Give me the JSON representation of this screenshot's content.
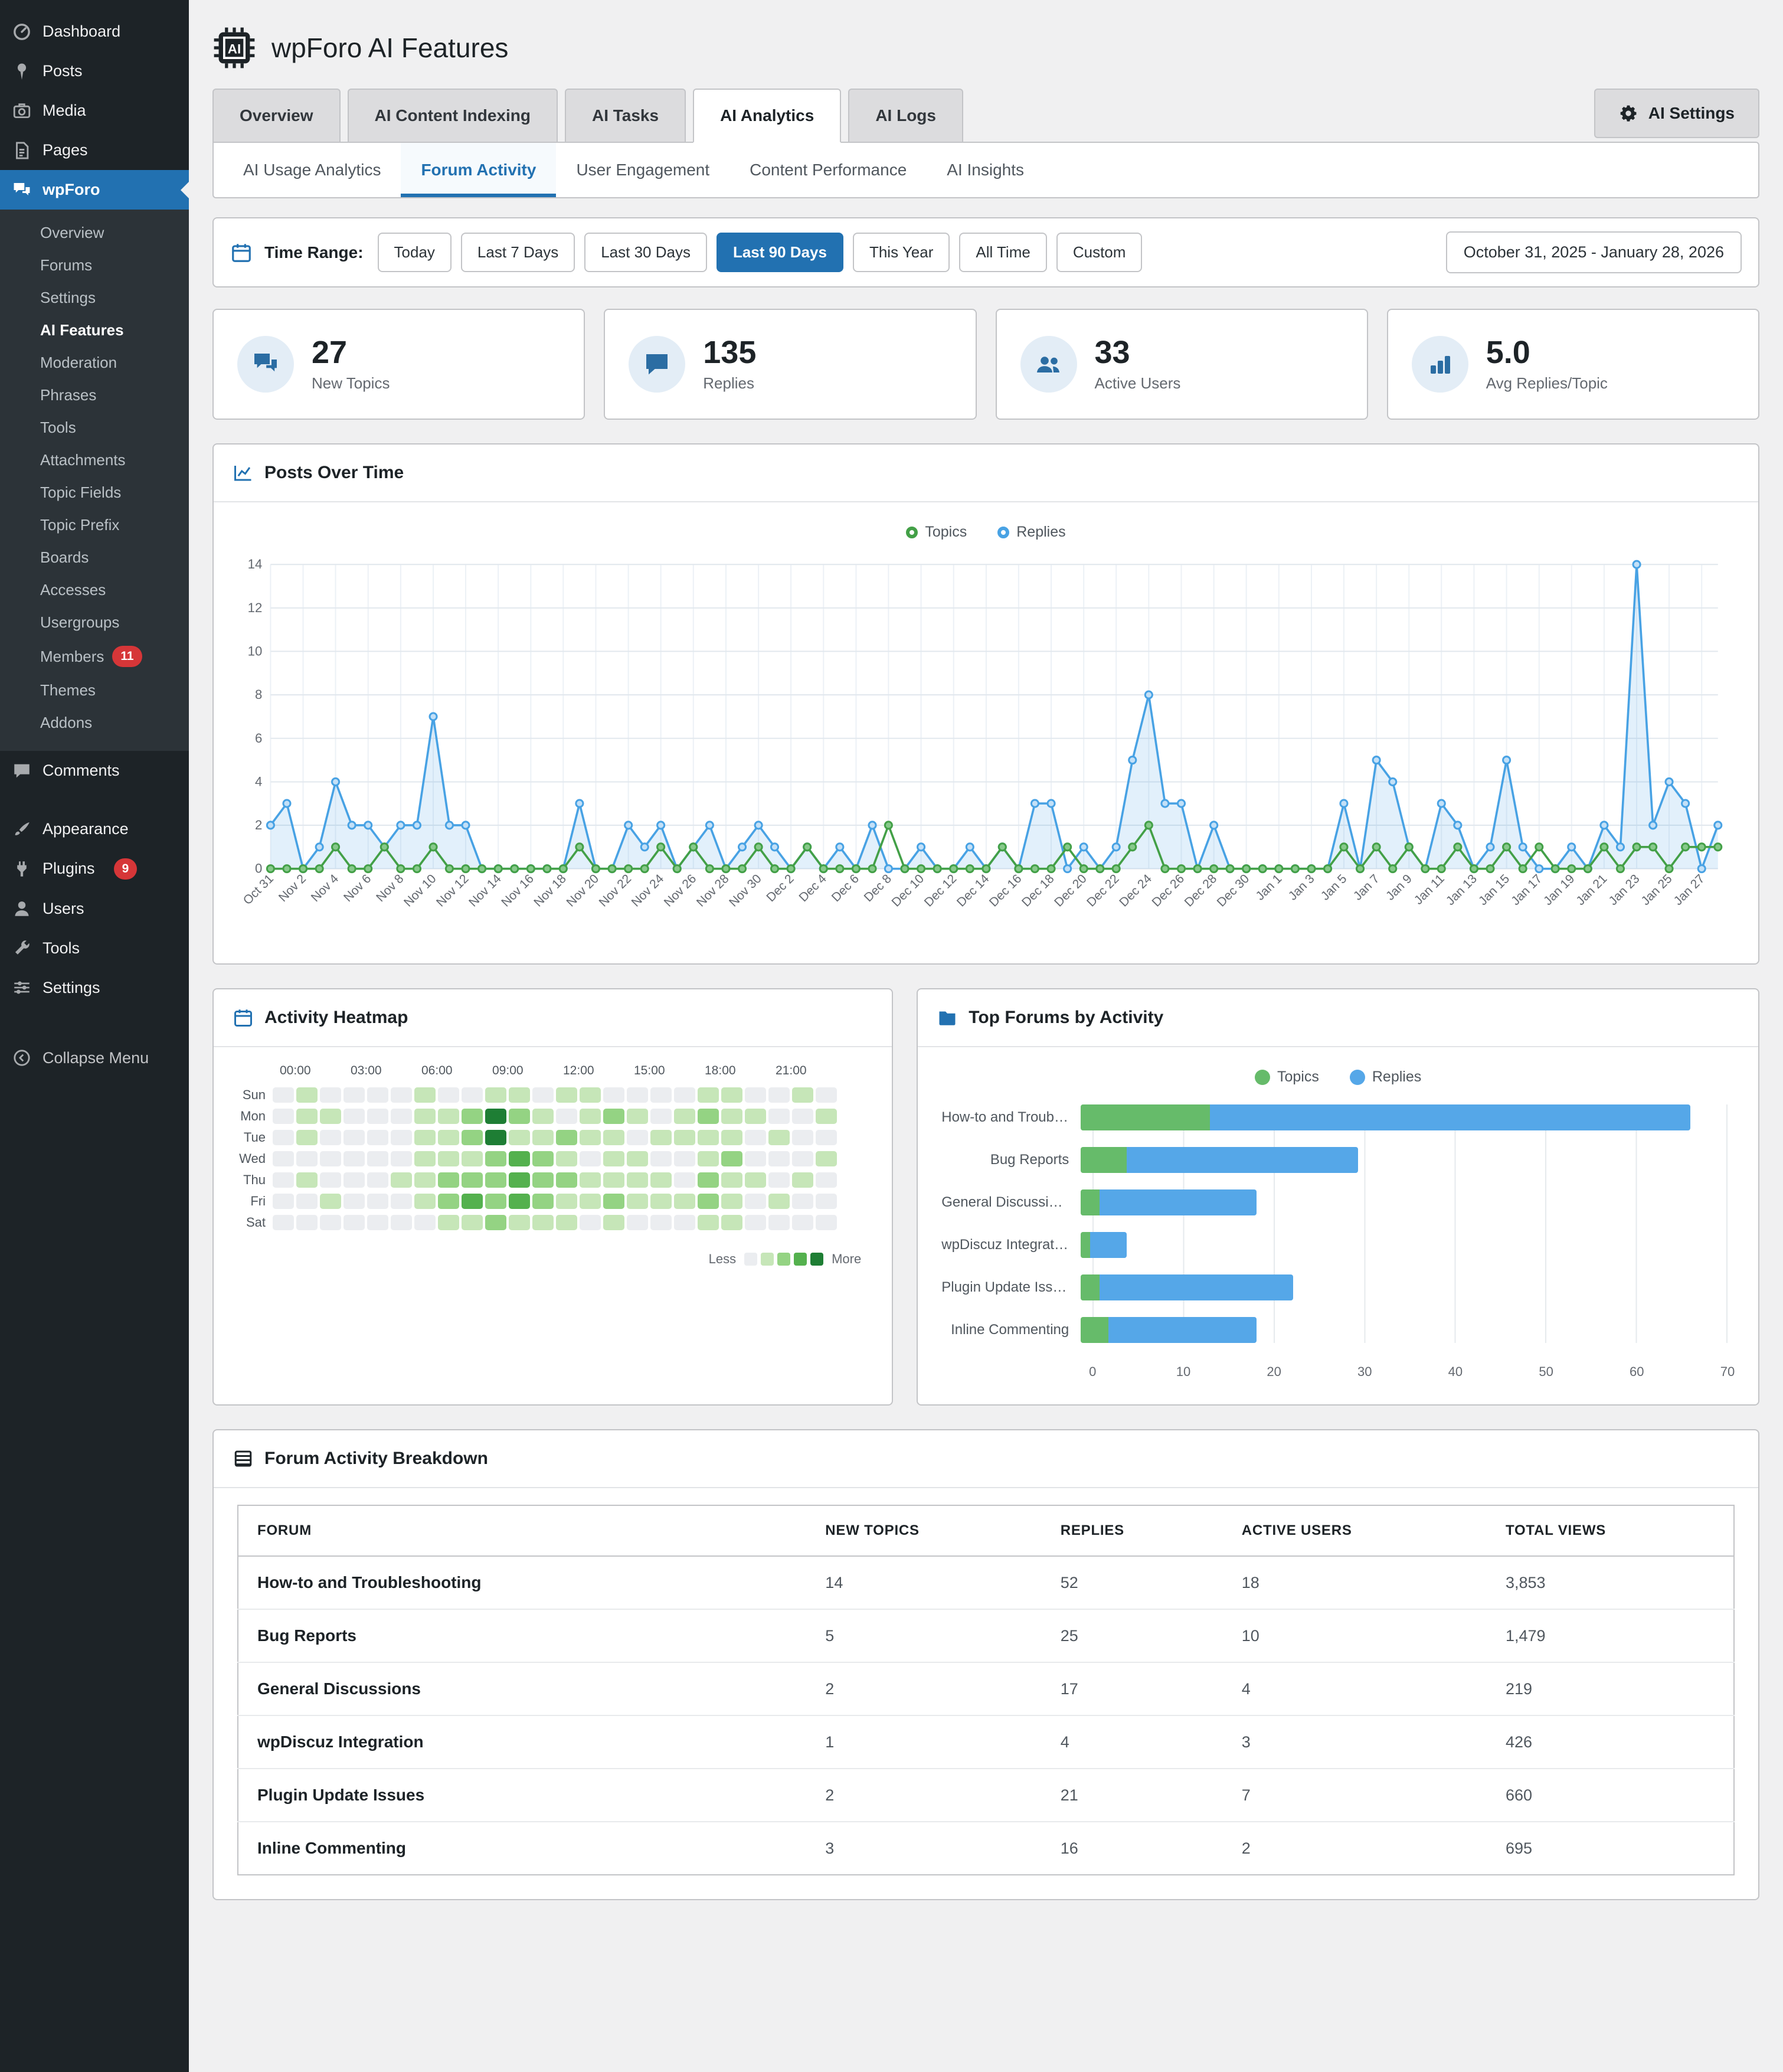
{
  "sidebar": {
    "top_items": [
      {
        "label": "Dashboard",
        "icon": "dashboard-icon"
      },
      {
        "label": "Posts",
        "icon": "posts-icon"
      },
      {
        "label": "Media",
        "icon": "media-icon"
      },
      {
        "label": "Pages",
        "icon": "pages-icon"
      }
    ],
    "wpforo": {
      "label": "wpForo",
      "icon": "wpforo-icon"
    },
    "wpforo_submenu": [
      {
        "label": "Overview"
      },
      {
        "label": "Forums"
      },
      {
        "label": "Settings"
      },
      {
        "label": "AI Features",
        "current": true
      },
      {
        "label": "Moderation"
      },
      {
        "label": "Phrases"
      },
      {
        "label": "Tools"
      },
      {
        "label": "Attachments"
      },
      {
        "label": "Topic Fields"
      },
      {
        "label": "Topic Prefix"
      },
      {
        "label": "Boards"
      },
      {
        "label": "Accesses"
      },
      {
        "label": "Usergroups"
      },
      {
        "label": "Members",
        "badge": "11"
      },
      {
        "label": "Themes"
      },
      {
        "label": "Addons"
      }
    ],
    "bottom_items": [
      {
        "label": "Comments",
        "icon": "comments-icon"
      },
      {
        "label": "Appearance",
        "icon": "appearance-icon",
        "group_start": true
      },
      {
        "label": "Plugins",
        "icon": "plugins-icon",
        "badge": "9"
      },
      {
        "label": "Users",
        "icon": "users-icon"
      },
      {
        "label": "Tools",
        "icon": "tools-icon"
      },
      {
        "label": "Settings",
        "icon": "settings-icon"
      }
    ],
    "collapse": {
      "label": "Collapse Menu",
      "icon": "collapse-icon"
    }
  },
  "header": {
    "title": "wpForo AI Features",
    "icon": "ai-chip-icon"
  },
  "tabs": [
    {
      "label": "Overview"
    },
    {
      "label": "AI Content Indexing"
    },
    {
      "label": "AI Tasks"
    },
    {
      "label": "AI Analytics",
      "active": true
    },
    {
      "label": "AI Logs"
    }
  ],
  "settings_button": {
    "label": "AI Settings",
    "icon": "gear-icon"
  },
  "subtabs": [
    {
      "label": "AI Usage Analytics"
    },
    {
      "label": "Forum Activity",
      "active": true
    },
    {
      "label": "User Engagement"
    },
    {
      "label": "Content Performance"
    },
    {
      "label": "AI Insights"
    }
  ],
  "time_range": {
    "label": "Time Range:",
    "icon": "calendar-icon",
    "options": [
      {
        "label": "Today"
      },
      {
        "label": "Last 7 Days"
      },
      {
        "label": "Last 30 Days"
      },
      {
        "label": "Last 90 Days",
        "active": true
      },
      {
        "label": "This Year"
      },
      {
        "label": "All Time"
      },
      {
        "label": "Custom"
      }
    ],
    "range_display": "October 31, 2025 - January 28, 2026"
  },
  "stats": [
    {
      "value": "27",
      "label": "New Topics",
      "icon": "topics-icon"
    },
    {
      "value": "135",
      "label": "Replies",
      "icon": "replies-icon"
    },
    {
      "value": "33",
      "label": "Active Users",
      "icon": "active-users-icon"
    },
    {
      "value": "5.0",
      "label": "Avg Replies/Topic",
      "icon": "avg-replies-icon"
    }
  ],
  "sections": {
    "posts_over_time": {
      "title": "Posts Over Time",
      "icon": "line-chart-icon"
    },
    "activity_heatmap": {
      "title": "Activity Heatmap",
      "icon": "calendar-icon",
      "legend_less": "Less",
      "legend_more": "More"
    },
    "top_forums": {
      "title": "Top Forums by Activity",
      "icon": "folder-icon"
    },
    "breakdown": {
      "title": "Forum Activity Breakdown",
      "icon": "table-icon"
    }
  },
  "chart_data": [
    {
      "id": "posts_over_time",
      "type": "line",
      "title": "Posts Over Time",
      "ylim": [
        0,
        14
      ],
      "ytick_step": 2,
      "x_label_every": 2,
      "grid": true,
      "legend_position": "top",
      "x": [
        "Oct 31",
        "Nov 1",
        "Nov 2",
        "Nov 3",
        "Nov 4",
        "Nov 5",
        "Nov 6",
        "Nov 7",
        "Nov 8",
        "Nov 9",
        "Nov 10",
        "Nov 11",
        "Nov 12",
        "Nov 13",
        "Nov 14",
        "Nov 15",
        "Nov 16",
        "Nov 17",
        "Nov 18",
        "Nov 19",
        "Nov 20",
        "Nov 21",
        "Nov 22",
        "Nov 23",
        "Nov 24",
        "Nov 25",
        "Nov 26",
        "Nov 27",
        "Nov 28",
        "Nov 29",
        "Nov 30",
        "Dec 1",
        "Dec 2",
        "Dec 3",
        "Dec 4",
        "Dec 5",
        "Dec 6",
        "Dec 7",
        "Dec 8",
        "Dec 9",
        "Dec 10",
        "Dec 11",
        "Dec 12",
        "Dec 13",
        "Dec 14",
        "Dec 15",
        "Dec 16",
        "Dec 17",
        "Dec 18",
        "Dec 19",
        "Dec 20",
        "Dec 21",
        "Dec 22",
        "Dec 23",
        "Dec 24",
        "Dec 25",
        "Dec 26",
        "Dec 27",
        "Dec 28",
        "Dec 29",
        "Dec 30",
        "Dec 31",
        "Jan 1",
        "Jan 2",
        "Jan 3",
        "Jan 4",
        "Jan 5",
        "Jan 6",
        "Jan 7",
        "Jan 8",
        "Jan 9",
        "Jan 10",
        "Jan 11",
        "Jan 12",
        "Jan 13",
        "Jan 14",
        "Jan 15",
        "Jan 16",
        "Jan 17",
        "Jan 18",
        "Jan 19",
        "Jan 20",
        "Jan 21",
        "Jan 22",
        "Jan 23",
        "Jan 24",
        "Jan 25",
        "Jan 26",
        "Jan 27",
        "Jan 28"
      ],
      "series": [
        {
          "name": "Topics",
          "color": "#43a047",
          "marker_fill": "#87c98b",
          "values": [
            0,
            0,
            0,
            0,
            1,
            0,
            0,
            1,
            0,
            0,
            1,
            0,
            0,
            0,
            0,
            0,
            0,
            0,
            0,
            1,
            0,
            0,
            0,
            0,
            1,
            0,
            1,
            0,
            0,
            0,
            1,
            0,
            0,
            1,
            0,
            0,
            0,
            0,
            2,
            0,
            0,
            0,
            0,
            0,
            0,
            1,
            0,
            0,
            0,
            1,
            0,
            0,
            0,
            1,
            2,
            0,
            0,
            0,
            0,
            0,
            0,
            0,
            0,
            0,
            0,
            0,
            1,
            0,
            1,
            0,
            1,
            0,
            0,
            1,
            0,
            0,
            1,
            0,
            1,
            0,
            0,
            0,
            1,
            0,
            1,
            1,
            0,
            1,
            1,
            1
          ]
        },
        {
          "name": "Replies",
          "color": "#48a2e4",
          "marker_fill": "#c3e0f7",
          "area": true,
          "area_fill": "rgba(72,162,228,0.16)",
          "values": [
            2,
            3,
            0,
            1,
            4,
            2,
            2,
            1,
            2,
            2,
            7,
            2,
            2,
            0,
            0,
            0,
            0,
            0,
            0,
            3,
            0,
            0,
            2,
            1,
            2,
            0,
            1,
            2,
            0,
            1,
            2,
            1,
            0,
            1,
            0,
            1,
            0,
            2,
            0,
            0,
            1,
            0,
            0,
            1,
            0,
            1,
            0,
            3,
            3,
            0,
            1,
            0,
            1,
            5,
            8,
            3,
            3,
            0,
            2,
            0,
            0,
            0,
            0,
            0,
            0,
            0,
            3,
            0,
            5,
            4,
            1,
            0,
            3,
            2,
            0,
            1,
            5,
            1,
            0,
            0,
            1,
            0,
            2,
            1,
            14,
            2,
            4,
            3,
            0,
            2
          ]
        }
      ]
    },
    {
      "id": "activity_heatmap",
      "type": "heatmap",
      "title": "Activity Heatmap",
      "hour_labels": [
        "00:00",
        "03:00",
        "06:00",
        "09:00",
        "12:00",
        "15:00",
        "18:00",
        "21:00"
      ],
      "day_labels": [
        "Sun",
        "Mon",
        "Tue",
        "Wed",
        "Thu",
        "Fri",
        "Sat"
      ],
      "palette": [
        "#ebedf0",
        "#c6e6b8",
        "#94d383",
        "#54b14e",
        "#1e7e34"
      ],
      "values": [
        [
          0,
          1,
          0,
          0,
          0,
          0,
          1,
          0,
          0,
          1,
          1,
          0,
          1,
          1,
          0,
          0,
          0,
          0,
          1,
          1,
          0,
          0,
          1,
          0
        ],
        [
          0,
          1,
          1,
          0,
          0,
          0,
          1,
          1,
          2,
          4,
          2,
          1,
          0,
          1,
          2,
          1,
          0,
          1,
          2,
          1,
          1,
          0,
          0,
          1
        ],
        [
          0,
          1,
          0,
          0,
          0,
          0,
          1,
          1,
          2,
          4,
          1,
          1,
          2,
          1,
          1,
          0,
          1,
          1,
          1,
          1,
          0,
          1,
          0,
          0
        ],
        [
          0,
          0,
          0,
          0,
          0,
          0,
          1,
          1,
          1,
          2,
          3,
          2,
          1,
          0,
          1,
          1,
          0,
          0,
          1,
          2,
          0,
          0,
          0,
          1
        ],
        [
          0,
          1,
          0,
          0,
          0,
          1,
          1,
          2,
          2,
          2,
          3,
          2,
          2,
          1,
          1,
          1,
          1,
          0,
          2,
          1,
          1,
          0,
          1,
          0
        ],
        [
          0,
          0,
          1,
          0,
          0,
          0,
          1,
          2,
          3,
          2,
          3,
          2,
          1,
          1,
          2,
          1,
          1,
          1,
          2,
          1,
          0,
          1,
          0,
          0
        ],
        [
          0,
          0,
          0,
          0,
          0,
          0,
          0,
          1,
          1,
          2,
          1,
          1,
          1,
          0,
          1,
          0,
          0,
          0,
          1,
          1,
          0,
          0,
          0,
          0
        ]
      ]
    },
    {
      "id": "top_forums",
      "type": "bar",
      "title": "Top Forums by Activity",
      "orientation": "horizontal",
      "stacked": true,
      "categories": [
        "How-to and Trouble...",
        "Bug Reports",
        "General Discussions",
        "wpDiscuz Integration",
        "Plugin Update Issues",
        "Inline Commenting"
      ],
      "series": [
        {
          "name": "Topics",
          "color": "#66bb6a",
          "values": [
            14,
            5,
            2,
            1,
            2,
            3
          ]
        },
        {
          "name": "Replies",
          "color": "#55a7e8",
          "values": [
            52,
            25,
            17,
            4,
            21,
            16
          ]
        }
      ],
      "xlim": [
        0,
        70
      ],
      "xtick_step": 10
    }
  ],
  "table": {
    "columns": [
      "FORUM",
      "NEW TOPICS",
      "REPLIES",
      "ACTIVE USERS",
      "TOTAL VIEWS"
    ],
    "rows": [
      {
        "forum": "How-to and Troubleshooting",
        "new_topics": "14",
        "replies": "52",
        "active_users": "18",
        "total_views": "3,853"
      },
      {
        "forum": "Bug Reports",
        "new_topics": "5",
        "replies": "25",
        "active_users": "10",
        "total_views": "1,479"
      },
      {
        "forum": "General Discussions",
        "new_topics": "2",
        "replies": "17",
        "active_users": "4",
        "total_views": "219"
      },
      {
        "forum": "wpDiscuz Integration",
        "new_topics": "1",
        "replies": "4",
        "active_users": "3",
        "total_views": "426"
      },
      {
        "forum": "Plugin Update Issues",
        "new_topics": "2",
        "replies": "21",
        "active_users": "7",
        "total_views": "660"
      },
      {
        "forum": "Inline Commenting",
        "new_topics": "3",
        "replies": "16",
        "active_users": "2",
        "total_views": "695"
      }
    ]
  }
}
